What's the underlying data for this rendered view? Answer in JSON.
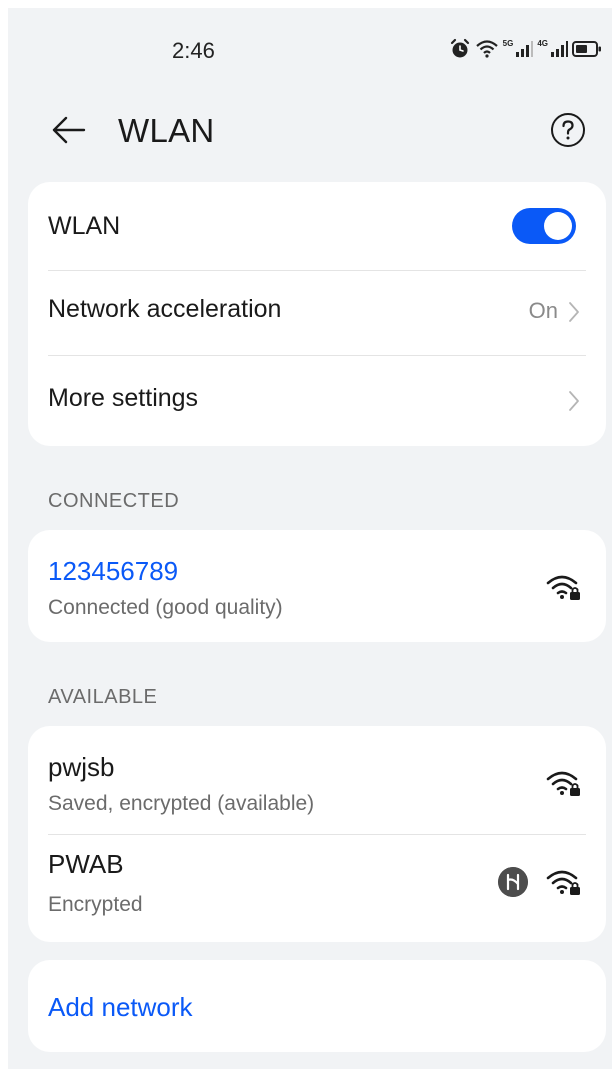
{
  "status_bar": {
    "time": "2:46",
    "network1_label": "5G",
    "network2_label": "4G",
    "icons": [
      "alarm-icon",
      "wifi-signal-icon",
      "cell-signal-icon",
      "cell-signal-icon",
      "battery-icon"
    ]
  },
  "header": {
    "title": "WLAN",
    "back_icon": "arrow-left-icon",
    "help_icon": "question-circle-icon"
  },
  "settings": {
    "wlan_label": "WLAN",
    "wlan_enabled": true,
    "acceleration_label": "Network acceleration",
    "acceleration_value": "On",
    "more_label": "More settings"
  },
  "connected": {
    "section_label": "CONNECTED",
    "name": "123456789",
    "status": "Connected (good quality)"
  },
  "available": {
    "section_label": "AVAILABLE",
    "networks": [
      {
        "name": "pwjsb",
        "status": "Saved, encrypted (available)"
      },
      {
        "name": "PWAB",
        "status": "Encrypted"
      }
    ]
  },
  "add_network_label": "Add network",
  "colors": {
    "accent": "#0a59f7",
    "background": "#f1f3f5",
    "card": "#ffffff"
  }
}
